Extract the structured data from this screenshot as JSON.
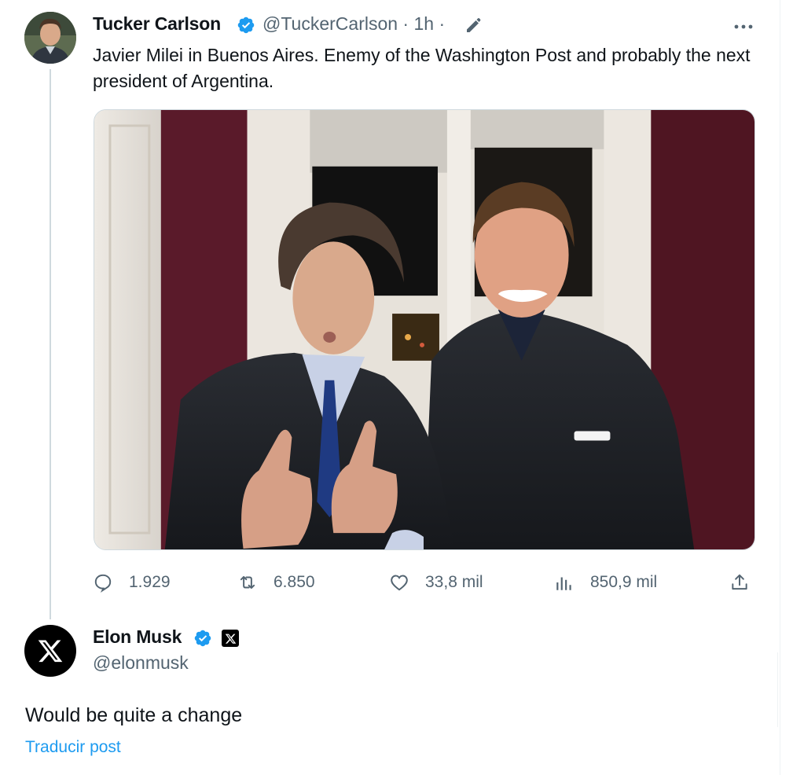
{
  "tweet": {
    "author_name": "Tucker Carlson",
    "author_handle": "@TuckerCarlson",
    "meta": "@TuckerCarlson · 1h ·",
    "text": "Javier Milei in Buenos Aires. Enemy of the Washington Post and probably the next president of Argentina.",
    "stats": {
      "replies": "1.929",
      "reposts": "6.850",
      "likes": "33,8 mil",
      "views": "850,9 mil"
    }
  },
  "reply": {
    "author_name": "Elon Musk",
    "author_handle": "@elonmusk",
    "text": "Would be quite a change",
    "translate_label": "Traducir post"
  },
  "icons": {
    "verified": "verified-badge-icon",
    "edit": "pencil-icon",
    "more": "more-icon",
    "reply": "reply-icon",
    "repost": "repost-icon",
    "like": "heart-icon",
    "views": "views-icon",
    "share": "share-icon",
    "x_logo": "x-logo-icon"
  },
  "colors": {
    "verified_blue": "#1d9bf0",
    "secondary_text": "#536471",
    "link": "#1d9bf0"
  }
}
